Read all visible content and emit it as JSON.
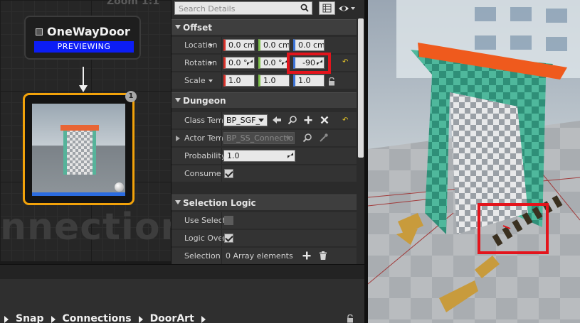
{
  "graph": {
    "zoom_label": "Zoom 1:1",
    "watermark": "nnection",
    "node_title": "OneWayDoor",
    "node_status": "PREVIEWING",
    "badge": "1"
  },
  "details": {
    "search_placeholder": "Search Details",
    "sections": {
      "offset": "Offset",
      "dungeon": "Dungeon",
      "selection_logic": "Selection Logic"
    },
    "offset": {
      "location": {
        "label": "Location",
        "x": "0.0 cm",
        "y": "0.0 cm",
        "z": "0.0 cm"
      },
      "rotation": {
        "label": "Rotation",
        "x": "0.0 °",
        "y": "0.0 °",
        "z": "-90"
      },
      "scale": {
        "label": "Scale",
        "x": "1.0",
        "y": "1.0",
        "z": "1.0"
      }
    },
    "dungeon": {
      "class_template": {
        "label": "Class Template",
        "value": "BP_SGF_"
      },
      "actor_template": {
        "label": "Actor Template",
        "value": "BP_SS_Connectio"
      },
      "probability": {
        "label": "Probability",
        "value": "1.0"
      },
      "consume": {
        "label": "Consume",
        "checked": true
      }
    },
    "selection_logic": {
      "use_selection": {
        "label": "Use Selection",
        "checked": false
      },
      "logic_override": {
        "label": "Logic Override",
        "checked": true
      },
      "selection": {
        "label": "Selection",
        "value": "0 Array elements"
      }
    }
  },
  "breadcrumb": [
    "Snap",
    "Connections",
    "DoorArt"
  ],
  "colors": {
    "node_border": "#f2a20a",
    "preview_bar": "#0c1df5",
    "highlight": "#e3141c",
    "axis_x": "#d9312a",
    "axis_y": "#7ec24a",
    "axis_z": "#3c73d8"
  }
}
